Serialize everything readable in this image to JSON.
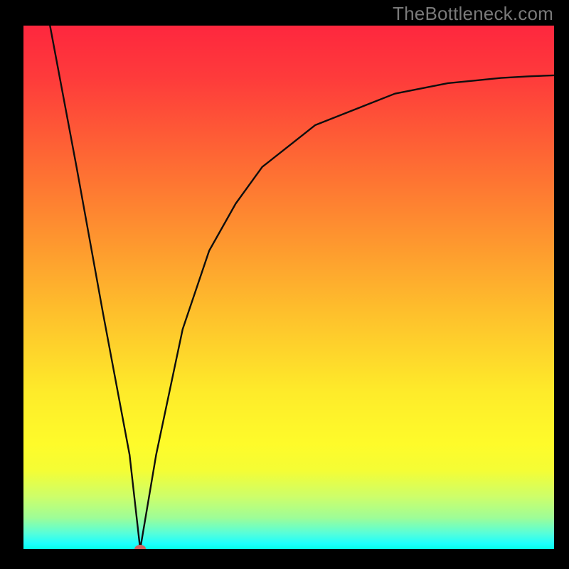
{
  "watermark": "TheBottleneck.com",
  "accent_colors": {
    "top": "#fe273e",
    "bottom": "#06fee6",
    "curve": "#0e0e0e",
    "marker": "#d2605e",
    "frame": "#000000"
  },
  "chart_data": {
    "type": "line",
    "title": "",
    "xlabel": "",
    "ylabel": "",
    "xlim": [
      0,
      100
    ],
    "ylim": [
      0,
      100
    ],
    "grid": false,
    "legend": false,
    "series": [
      {
        "name": "curve",
        "x": [
          5,
          10,
          15,
          20,
          22,
          25,
          30,
          35,
          40,
          45,
          50,
          55,
          60,
          65,
          70,
          75,
          80,
          85,
          90,
          95,
          100
        ],
        "y": [
          100,
          73,
          45,
          18,
          0,
          18,
          42,
          57,
          66,
          73,
          77,
          81,
          83,
          85,
          87,
          88,
          89,
          89.5,
          90,
          90.3,
          90.5
        ]
      }
    ],
    "marker": {
      "x": 22,
      "y": 0
    },
    "annotations": []
  }
}
